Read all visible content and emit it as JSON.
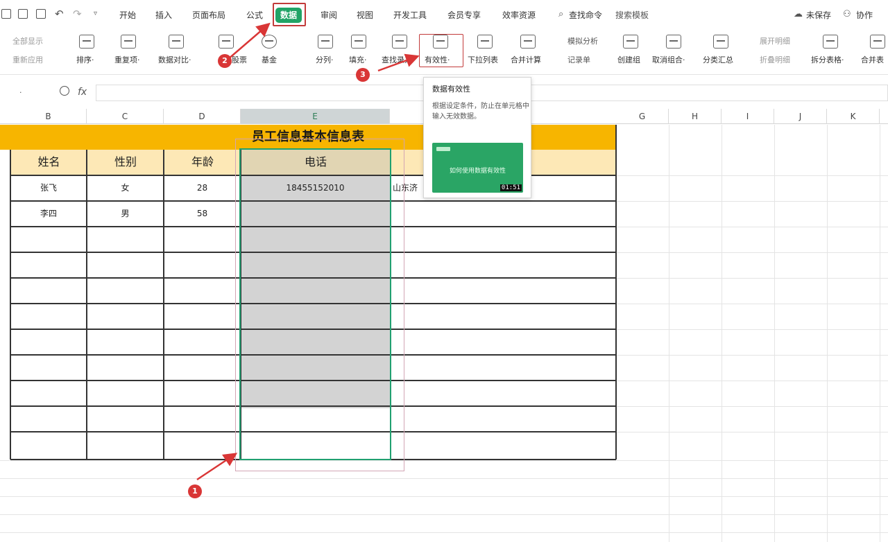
{
  "menu": {
    "tabs": [
      "开始",
      "插入",
      "页面布局",
      "公式",
      "数据",
      "审阅",
      "视图",
      "开发工具",
      "会员专享",
      "效率资源"
    ],
    "active_tab": "数据",
    "search": "查找命令",
    "search_template": "搜索模板",
    "unsaved": "未保存",
    "collaborate": "协作"
  },
  "ribbon": {
    "show_all": "全部显示",
    "reapply": "重新应用",
    "sort": "排序·",
    "duplicates": "重复项·",
    "data_compare": "数据对比·",
    "stock": "股票",
    "fund": "基金",
    "split_column": "分列·",
    "fill": "填充·",
    "find_entry": "查找录入",
    "validity": "有效性·",
    "dropdown_list": "下拉列表",
    "consolidate": "合并计算",
    "simulation": "模拟分析",
    "record_form": "记录单",
    "create_group": "创建组",
    "ungroup": "取消组合·",
    "subtotal": "分类汇总",
    "expand_detail": "展开明细",
    "collapse_detail": "折叠明细",
    "split_table": "拆分表格·",
    "merge_table": "合并表"
  },
  "formula_bar": {
    "fx": "fx"
  },
  "columns": [
    "B",
    "C",
    "D",
    "E",
    "G",
    "H",
    "I",
    "J",
    "K"
  ],
  "table": {
    "title": "员工信息基本信息表",
    "headers": [
      "姓名",
      "性别",
      "年龄",
      "电话"
    ],
    "rows": [
      [
        "张飞",
        "女",
        "28",
        "18455152010",
        "山东济"
      ],
      [
        "李四",
        "男",
        "58",
        "",
        ""
      ]
    ]
  },
  "tooltip": {
    "title": "数据有效性",
    "description": "根据设定条件，防止在单元格中输入无效数据。",
    "video_label": "如何使用数据有效性",
    "video_time": "01:51"
  },
  "annotations": [
    "1",
    "2",
    "3"
  ],
  "colors": {
    "accent": "#21a366",
    "title_fill": "#f7b500",
    "header_fill": "#fde8b6",
    "annotation_red": "#d93636"
  }
}
